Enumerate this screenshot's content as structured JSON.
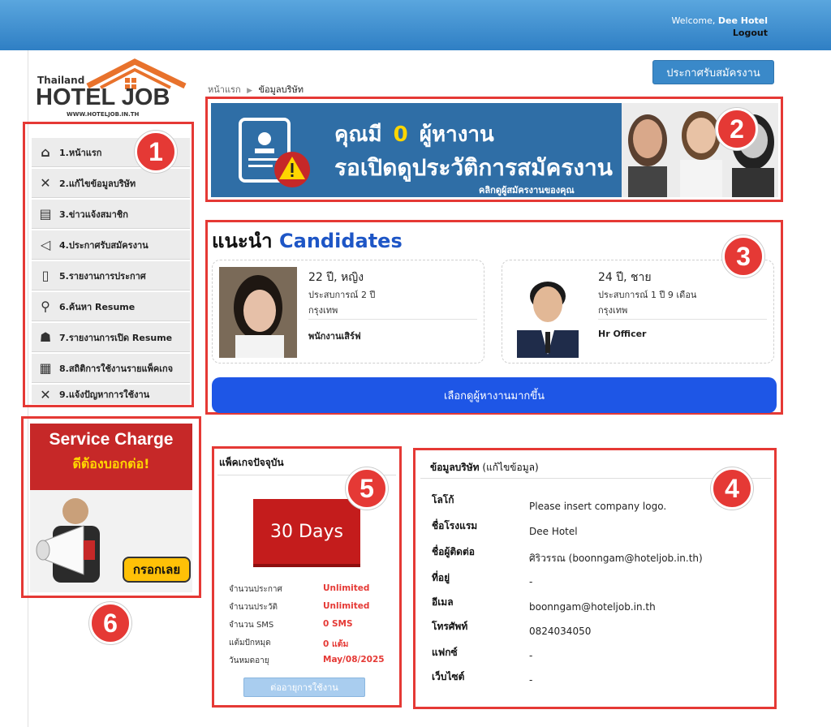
{
  "header": {
    "welcome_prefix": "Welcome,",
    "user": "Dee Hotel",
    "logout": "Logout"
  },
  "logo": {
    "line1": "Thailand",
    "line2": "HOTEL JOB",
    "url": "WWW.HOTELJOB.IN.TH"
  },
  "sidebar": {
    "items": [
      {
        "label": "1.หน้าแรก",
        "icon": "home-icon"
      },
      {
        "label": "2.แก้ไขข้อมูลบริษัท",
        "icon": "tools-icon"
      },
      {
        "label": "3.ข่าวแจ้งสมาชิก",
        "icon": "newspaper-icon"
      },
      {
        "label": "4.ประกาศรับสมัครงาน",
        "icon": "megaphone-icon"
      },
      {
        "label": "5.รายงานการประกาศ",
        "icon": "document-icon"
      },
      {
        "label": "6.ค้นหา Resume",
        "icon": "search-person-icon"
      },
      {
        "label": "7.รายงานการเปิด Resume",
        "icon": "report-icon"
      },
      {
        "label": "8.สถิติการใช้งานรายแพ็คเกจ",
        "icon": "stats-icon"
      },
      {
        "label": "9.แจ้งปัญหาการใช้งาน",
        "icon": "tools-icon"
      }
    ]
  },
  "promo": {
    "title": "Service Charge",
    "subtitle": "ดีต้องบอกต่อ!",
    "button": "กรอกเลย"
  },
  "breadcrumb": {
    "home": "หน้าแรก",
    "current": "ข้อมูลบริษัท"
  },
  "post_job_button": "ประกาศรับสมัครงาน",
  "banner": {
    "line1_prefix": "คุณมี",
    "count": "0",
    "line1_suffix": "ผู้หางาน",
    "line2": "รอเปิดดูประวัติการสมัครงาน",
    "line3": "คลิกดูผู้สมัครงานของคุณ"
  },
  "candidates": {
    "title_th": "แนะนำ",
    "title_en": "Candidates",
    "items": [
      {
        "age": "22 ปี, หญิง",
        "experience": "ประสบการณ์ 2 ปี",
        "location": "กรุงเทพ",
        "position": "พนักงานเสิร์ฟ"
      },
      {
        "age": "24 ปี, ชาย",
        "experience": "ประสบการณ์ 1 ปี 9 เดือน",
        "location": "กรุงเทพ",
        "position": "Hr Officer"
      }
    ],
    "more_button": "เลือกดูผู้หางานมากขึ้น"
  },
  "package": {
    "title": "แพ็คเกจปัจจุบัน",
    "days": "30 Days",
    "rows": [
      {
        "label": "จำนวนประกาศ",
        "value": "Unlimited"
      },
      {
        "label": "จำนวนประวัติ",
        "value": "Unlimited"
      },
      {
        "label": "จำนวน SMS",
        "value": "0 SMS"
      },
      {
        "label": "แต้มปักหมุด",
        "value": "0 แต้ม"
      },
      {
        "label": "วันหมดอายุ",
        "value": "May/08/2025"
      }
    ],
    "renew_button": "ต่ออายุการใช้งาน"
  },
  "company": {
    "title": "ข้อมูลบริษัท",
    "edit_link": "(แก้ไขข้อมูล)",
    "rows": [
      {
        "label": "โลโก้",
        "value": "Please insert company logo."
      },
      {
        "label": "ชื่อโรงแรม",
        "value": "Dee Hotel"
      },
      {
        "label": "ชื่อผู้ติดต่อ",
        "value": "ศิริวรรณ (boonngam@hoteljob.in.th)"
      },
      {
        "label": "ที่อยู่",
        "value": "-"
      },
      {
        "label": "อีเมล",
        "value": "boonngam@hoteljob.in.th"
      },
      {
        "label": "โทรศัพท์",
        "value": "0824034050"
      },
      {
        "label": "แฟกซ์",
        "value": "-"
      },
      {
        "label": "เว็บไซต์",
        "value": "-"
      }
    ]
  },
  "badges": [
    "1",
    "2",
    "3",
    "4",
    "5",
    "6"
  ],
  "colors": {
    "accent_red": "#e53935",
    "header_blue": "#3a89c9",
    "cta_blue": "#1e56e6",
    "package_red": "#c41c1c"
  }
}
